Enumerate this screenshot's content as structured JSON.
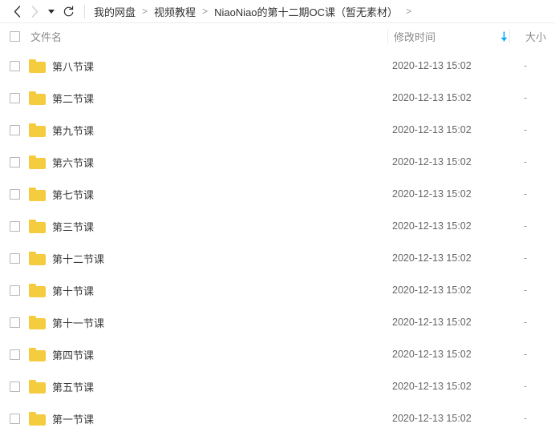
{
  "toolbar": {
    "back_icon": "chevron-left-icon",
    "forward_icon": "chevron-right-icon",
    "history_caret_icon": "caret-down-icon",
    "refresh_icon": "refresh-icon",
    "breadcrumb": {
      "items": [
        {
          "label": "我的网盘"
        },
        {
          "label": "视频教程"
        },
        {
          "label": "NiaoNiao的第十二期OC课（暂无素材）"
        }
      ],
      "separator": ">",
      "trailing_separator": ">"
    }
  },
  "list": {
    "select_all_checkbox": false,
    "columns": {
      "name": "文件名",
      "time": "修改时间",
      "size": "大小"
    },
    "sort": {
      "column": "修改时间",
      "direction": "desc",
      "arrow_icon": "arrow-down-icon",
      "arrow_color": "#06a7ff"
    },
    "folder_icon": "folder-icon",
    "folder_color": "#F5CC3F",
    "rows": [
      {
        "name": "第八节课",
        "time": "2020-12-13 15:02",
        "size": "-",
        "checked": false
      },
      {
        "name": "第二节课",
        "time": "2020-12-13 15:02",
        "size": "-",
        "checked": false
      },
      {
        "name": "第九节课",
        "time": "2020-12-13 15:02",
        "size": "-",
        "checked": false
      },
      {
        "name": "第六节课",
        "time": "2020-12-13 15:02",
        "size": "-",
        "checked": false
      },
      {
        "name": "第七节课",
        "time": "2020-12-13 15:02",
        "size": "-",
        "checked": false
      },
      {
        "name": "第三节课",
        "time": "2020-12-13 15:02",
        "size": "-",
        "checked": false
      },
      {
        "name": "第十二节课",
        "time": "2020-12-13 15:02",
        "size": "-",
        "checked": false
      },
      {
        "name": "第十节课",
        "time": "2020-12-13 15:02",
        "size": "-",
        "checked": false
      },
      {
        "name": "第十一节课",
        "time": "2020-12-13 15:02",
        "size": "-",
        "checked": false
      },
      {
        "name": "第四节课",
        "time": "2020-12-13 15:02",
        "size": "-",
        "checked": false
      },
      {
        "name": "第五节课",
        "time": "2020-12-13 15:02",
        "size": "-",
        "checked": false
      },
      {
        "name": "第一节课",
        "time": "2020-12-13 15:02",
        "size": "-",
        "checked": false
      }
    ]
  }
}
